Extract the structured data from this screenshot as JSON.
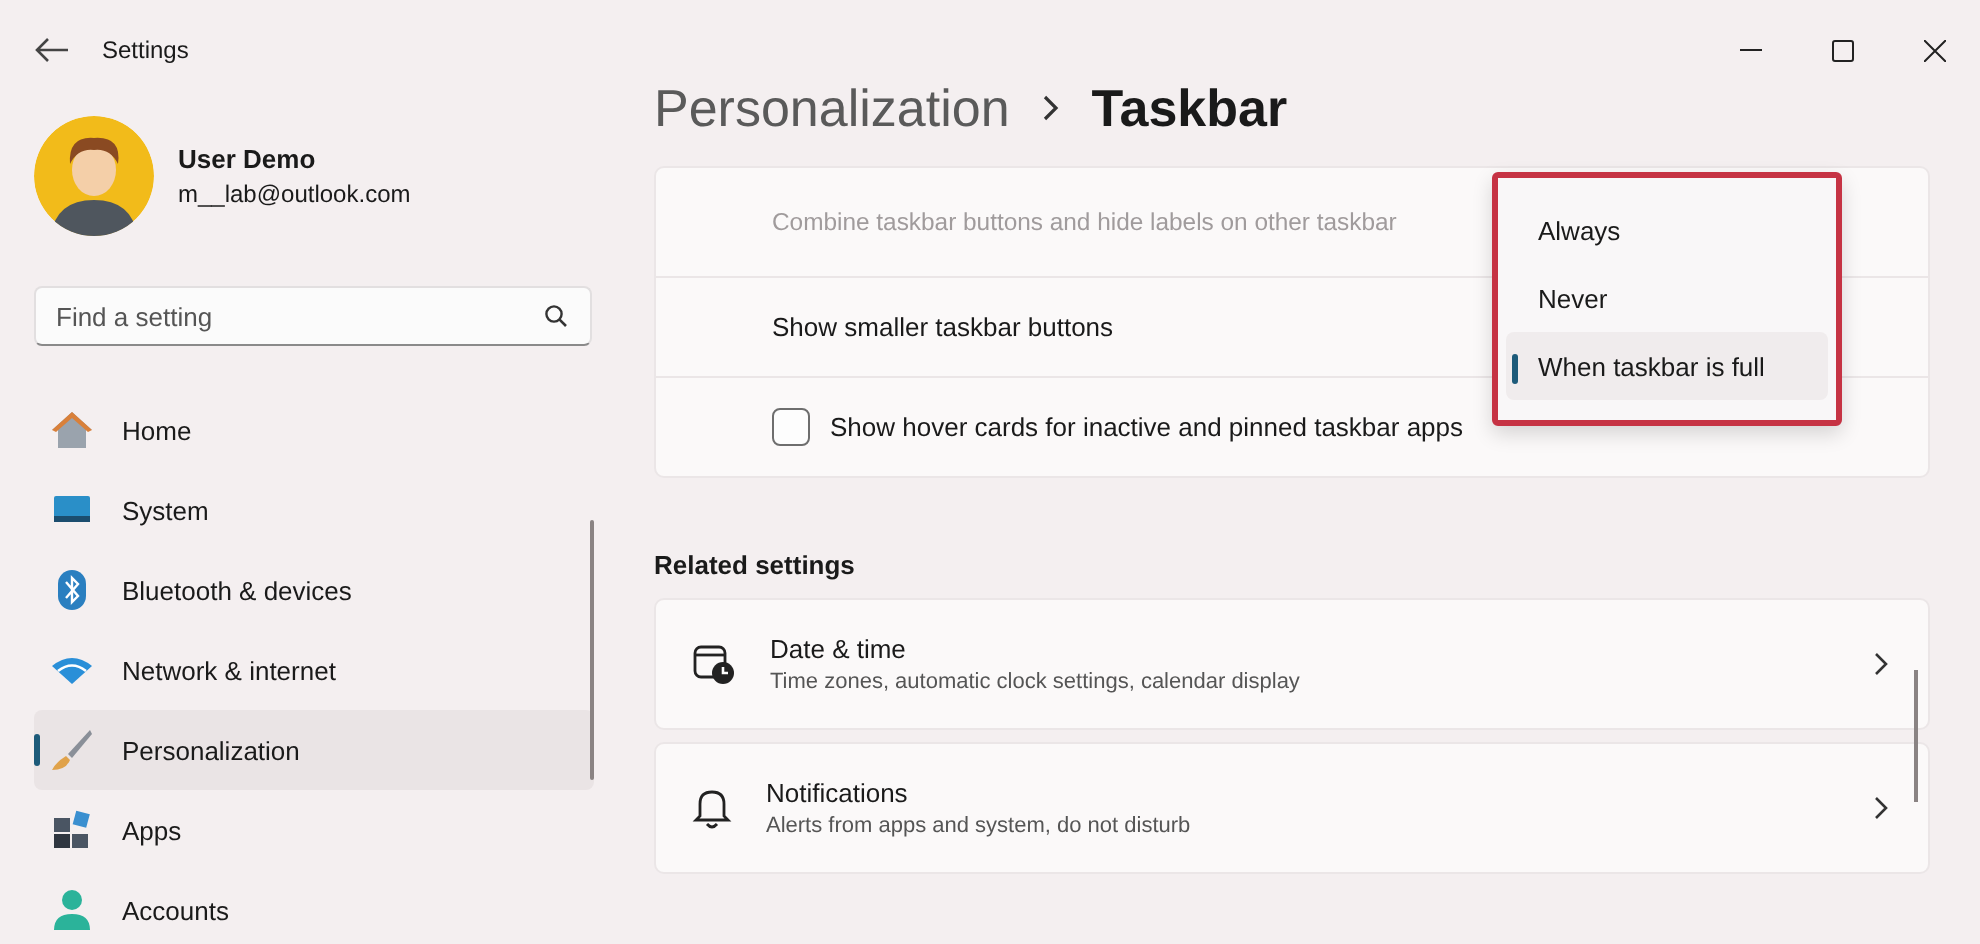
{
  "window": {
    "title": "Settings"
  },
  "profile": {
    "name": "User Demo",
    "email": "m__lab@outlook.com"
  },
  "search": {
    "placeholder": "Find a setting"
  },
  "nav": [
    {
      "label": "Home",
      "kind": "home",
      "selected": false
    },
    {
      "label": "System",
      "kind": "system",
      "selected": false
    },
    {
      "label": "Bluetooth & devices",
      "kind": "bluetooth",
      "selected": false
    },
    {
      "label": "Network & internet",
      "kind": "network",
      "selected": false
    },
    {
      "label": "Personalization",
      "kind": "personalization",
      "selected": true
    },
    {
      "label": "Apps",
      "kind": "apps",
      "selected": false
    },
    {
      "label": "Accounts",
      "kind": "accounts",
      "selected": false
    }
  ],
  "breadcrumb": [
    "Personalization",
    "Taskbar"
  ],
  "settings": [
    {
      "kind": "text",
      "label": "Combine taskbar buttons and hide labels on other taskbar",
      "disabled": true
    },
    {
      "kind": "text",
      "label": "Show smaller taskbar buttons",
      "disabled": false
    },
    {
      "kind": "checkbox",
      "label": "Show hover cards for inactive and pinned taskbar apps",
      "checked": false
    }
  ],
  "dropdown": {
    "options": [
      {
        "label": "Always",
        "selected": false
      },
      {
        "label": "Never",
        "selected": false
      },
      {
        "label": "When taskbar is full",
        "selected": true
      }
    ]
  },
  "related": {
    "heading": "Related settings",
    "items": [
      {
        "kind": "datetime",
        "title": "Date & time",
        "description": "Time zones, automatic clock settings, calendar display"
      },
      {
        "kind": "notifications",
        "title": "Notifications",
        "description": "Alerts from apps and system, do not disturb"
      }
    ]
  }
}
